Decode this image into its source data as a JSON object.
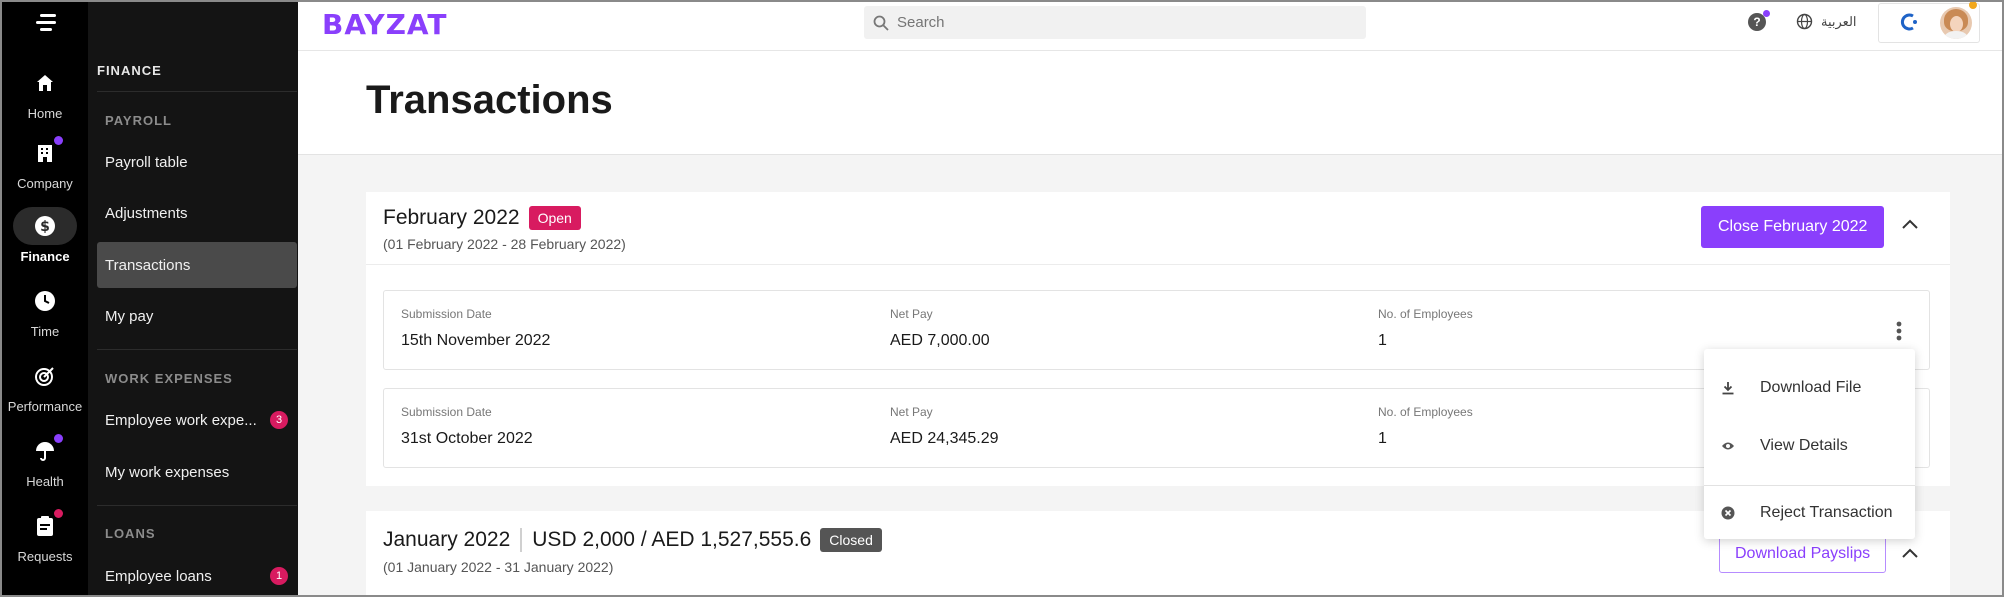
{
  "app": {
    "logo": "BAYZAT"
  },
  "rail": [
    {
      "label": "Home",
      "icon": "home-icon",
      "active": false,
      "dot": ""
    },
    {
      "label": "Company",
      "icon": "building-icon",
      "active": false,
      "dot": "#8a3ffc"
    },
    {
      "label": "Finance",
      "icon": "dollar-icon",
      "active": true,
      "dot": ""
    },
    {
      "label": "Time",
      "icon": "clock-icon",
      "active": false,
      "dot": ""
    },
    {
      "label": "Performance",
      "icon": "target-icon",
      "active": false,
      "dot": ""
    },
    {
      "label": "Health",
      "icon": "umbrella-icon",
      "active": false,
      "dot": "#8a3ffc"
    },
    {
      "label": "Requests",
      "icon": "clipboard-icon",
      "active": false,
      "dot": "#d81b60"
    }
  ],
  "subnav": {
    "heading": "FINANCE",
    "payroll": {
      "label": "PAYROLL",
      "items": [
        {
          "label": "Payroll table",
          "active": false
        },
        {
          "label": "Adjustments",
          "active": false
        },
        {
          "label": "Transactions",
          "active": true
        },
        {
          "label": "My pay",
          "active": false
        }
      ]
    },
    "work_expenses": {
      "label": "WORK EXPENSES",
      "items": [
        {
          "label": "Employee work expe...",
          "badge": "3"
        },
        {
          "label": "My work expenses",
          "badge": ""
        }
      ]
    },
    "loans": {
      "label": "LOANS",
      "items": [
        {
          "label": "Employee loans",
          "badge": "1"
        }
      ]
    }
  },
  "topbar": {
    "search_placeholder": "Search",
    "help": "?",
    "language": "العربية"
  },
  "page": {
    "title": "Transactions"
  },
  "periods": [
    {
      "name": "February 2022",
      "status": "Open",
      "range": "(01 February 2022 - 28 February 2022)",
      "action": "Close February 2022",
      "transactions": [
        {
          "submission_label": "Submission Date",
          "submission": "15th November 2022",
          "netpay_label": "Net Pay",
          "netpay": "AED 7,000.00",
          "employees_label": "No. of Employees",
          "employees": "1"
        },
        {
          "submission_label": "Submission Date",
          "submission": "31st October 2022",
          "netpay_label": "Net Pay",
          "netpay": "AED 24,345.29",
          "employees_label": "No. of Employees",
          "employees": "1"
        }
      ]
    },
    {
      "name": "January 2022",
      "amount": "USD 2,000 / AED 1,527,555.6",
      "status": "Closed",
      "range": "(01 January 2022 - 31 January 2022)",
      "action": "Download Payslips"
    }
  ],
  "context_menu": {
    "items": [
      {
        "label": "Download File",
        "icon": "download-icon"
      },
      {
        "label": "View Details",
        "icon": "eye-icon"
      },
      {
        "label": "Reject Transaction",
        "icon": "close-circle-icon"
      }
    ]
  },
  "colors": {
    "accent": "#8a3ffc",
    "open": "#d81b60",
    "closed": "#555555",
    "sidebar": "#000000"
  }
}
